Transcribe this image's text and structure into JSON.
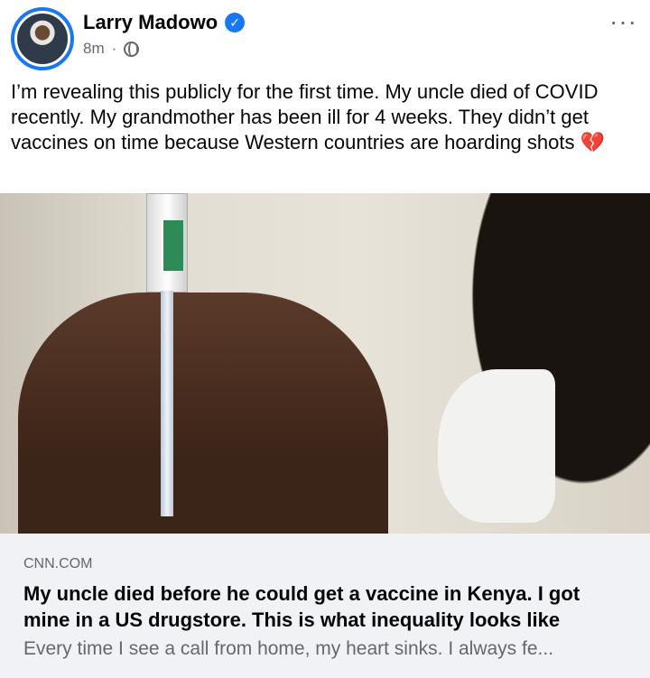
{
  "post": {
    "author": "Larry Madowo",
    "time": "8m",
    "separator": "·",
    "text": "I’m revealing this publicly for the first time. My uncle died of COVID recently. My grandmother has been ill for 4 weeks. They didn’t get vaccines on time because Western countries are hoarding shots 💔"
  },
  "link": {
    "domain": "CNN.COM",
    "title": "My uncle died before he could get a vaccine in Kenya. I got mine in a US drugstore. This is what inequality looks like",
    "description": "Every time I see a call from home, my heart sinks. I always fe..."
  },
  "icons": {
    "verified": "verified-badge-icon",
    "audience": "globe-icon",
    "more": "more-options-icon"
  },
  "colors": {
    "accent": "#1877f2",
    "secondary_text": "#65676b",
    "card_background": "#f0f2f5"
  }
}
